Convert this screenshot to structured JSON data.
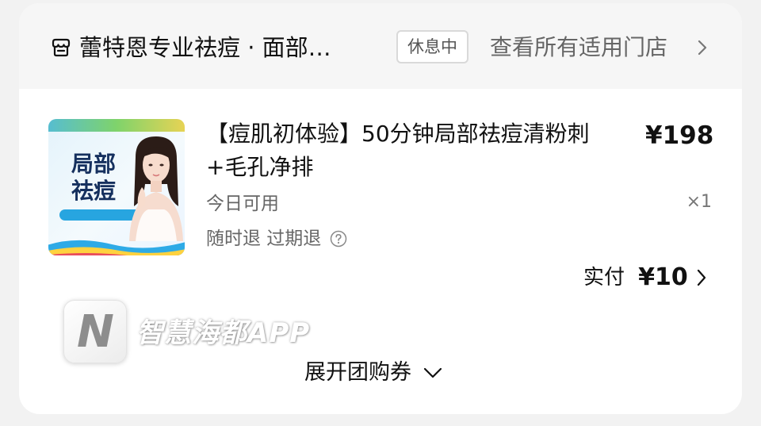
{
  "store": {
    "icon": "store-icon",
    "name": "蕾特恩专业祛痘 · 面部…",
    "status": "休息中",
    "all_stores_link": "查看所有适用门店"
  },
  "product": {
    "thumbnail": {
      "title": "局部祛痘"
    },
    "title": "【痘肌初体验】50分钟局部祛痘清粉刺+毛孔净排",
    "price": "¥198",
    "quantity": "×1",
    "usage": "今日可用",
    "refund_policy": "随时退 过期退"
  },
  "payment": {
    "label": "实付",
    "amount": "¥10"
  },
  "watermark": {
    "logo_letter": "N",
    "text": "智慧海都APP"
  },
  "expand": {
    "label": "展开团购券",
    "icon": "chevron-down-icon"
  },
  "colors": {
    "card_background": "#ffffff",
    "header_background": "#f6f6f6",
    "page_background": "#f2f2f2",
    "primary_text": "#111111",
    "secondary_text": "#666666",
    "thumb_title": "#15305e",
    "thumb_accent": "#27a5e0"
  }
}
